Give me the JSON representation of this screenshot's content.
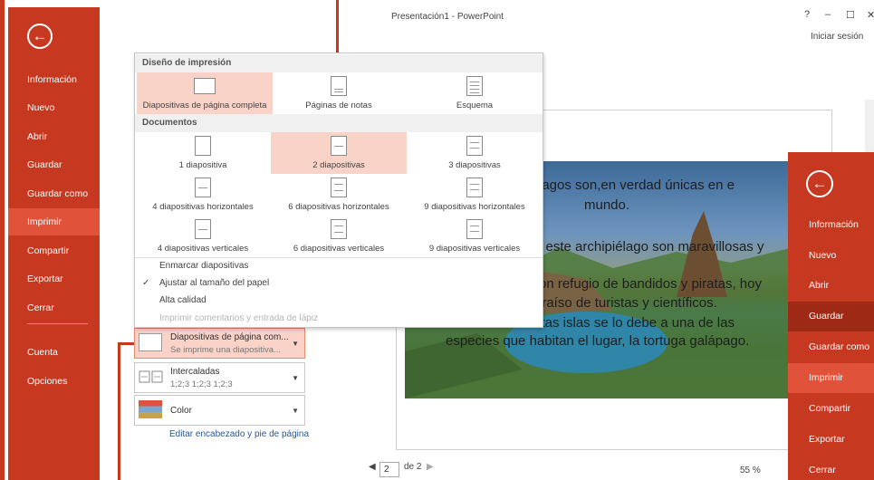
{
  "window": {
    "title": "Presentación1 - PowerPoint",
    "controls": [
      "?",
      "–",
      "☐",
      "✕"
    ],
    "signin": "Iniciar sesión"
  },
  "sidebar": {
    "back": "←",
    "items": [
      "Información",
      "Nuevo",
      "Abrir",
      "Guardar",
      "Guardar como",
      "Imprimir",
      "Compartir",
      "Exportar",
      "Cerrar"
    ],
    "active": "Imprimir",
    "bottom": [
      "Cuenta",
      "Opciones"
    ]
  },
  "dropdown": {
    "print_layout_header": "Diseño de impresión",
    "print_layouts": [
      "Diapositivas de página completa",
      "Páginas de notas",
      "Esquema"
    ],
    "handouts_header": "Documentos",
    "handouts": [
      "1 diapositiva",
      "2 diapositivas",
      "3 diapositivas",
      "4 diapositivas horizontales",
      "6 diapositivas horizontales",
      "9 diapositivas horizontales",
      "4 diapositivas verticales",
      "6 diapositivas verticales",
      "9 diapositivas verticales"
    ],
    "options": [
      "Enmarcar diapositivas",
      "Ajustar al tamaño del papel",
      "Alta calidad",
      "Imprimir comentarios y entrada de lápiz"
    ],
    "check": "✓"
  },
  "settings": {
    "layout": {
      "title": "Diapositivas de página com...",
      "subtitle": "Se imprime una diapositiva..."
    },
    "collate": {
      "title": "Intercaladas",
      "subtitle": "1;2;3   1;2;3   1;2;3"
    },
    "color": {
      "title": "Color"
    },
    "edit_link": "Editar encabezado y pie de página"
  },
  "preview": {
    "lines": [
      "bagos son,en verdad únicas en e",
      "mundo.",
      "e este archipiélago son maravillosas y",
      "ron refugio de bandidos y piratas, hoy",
      "araíso de turistas y científicos.",
      "stas islas se lo debe a una de las",
      "especies que habitan el lugar, la tortuga galápago."
    ],
    "page_current": "2",
    "page_total": "de 2",
    "zoom": "55 %"
  },
  "right_panel": {
    "back": "←",
    "items": [
      "Información",
      "Nuevo",
      "Abrir",
      "Guardar",
      "Guardar como",
      "Imprimir",
      "Compartir",
      "Exportar",
      "Cerrar"
    ]
  },
  "colors": {
    "accent": "#c6381f",
    "accent_light": "#e0533a",
    "selection": "#f9d3c7"
  }
}
